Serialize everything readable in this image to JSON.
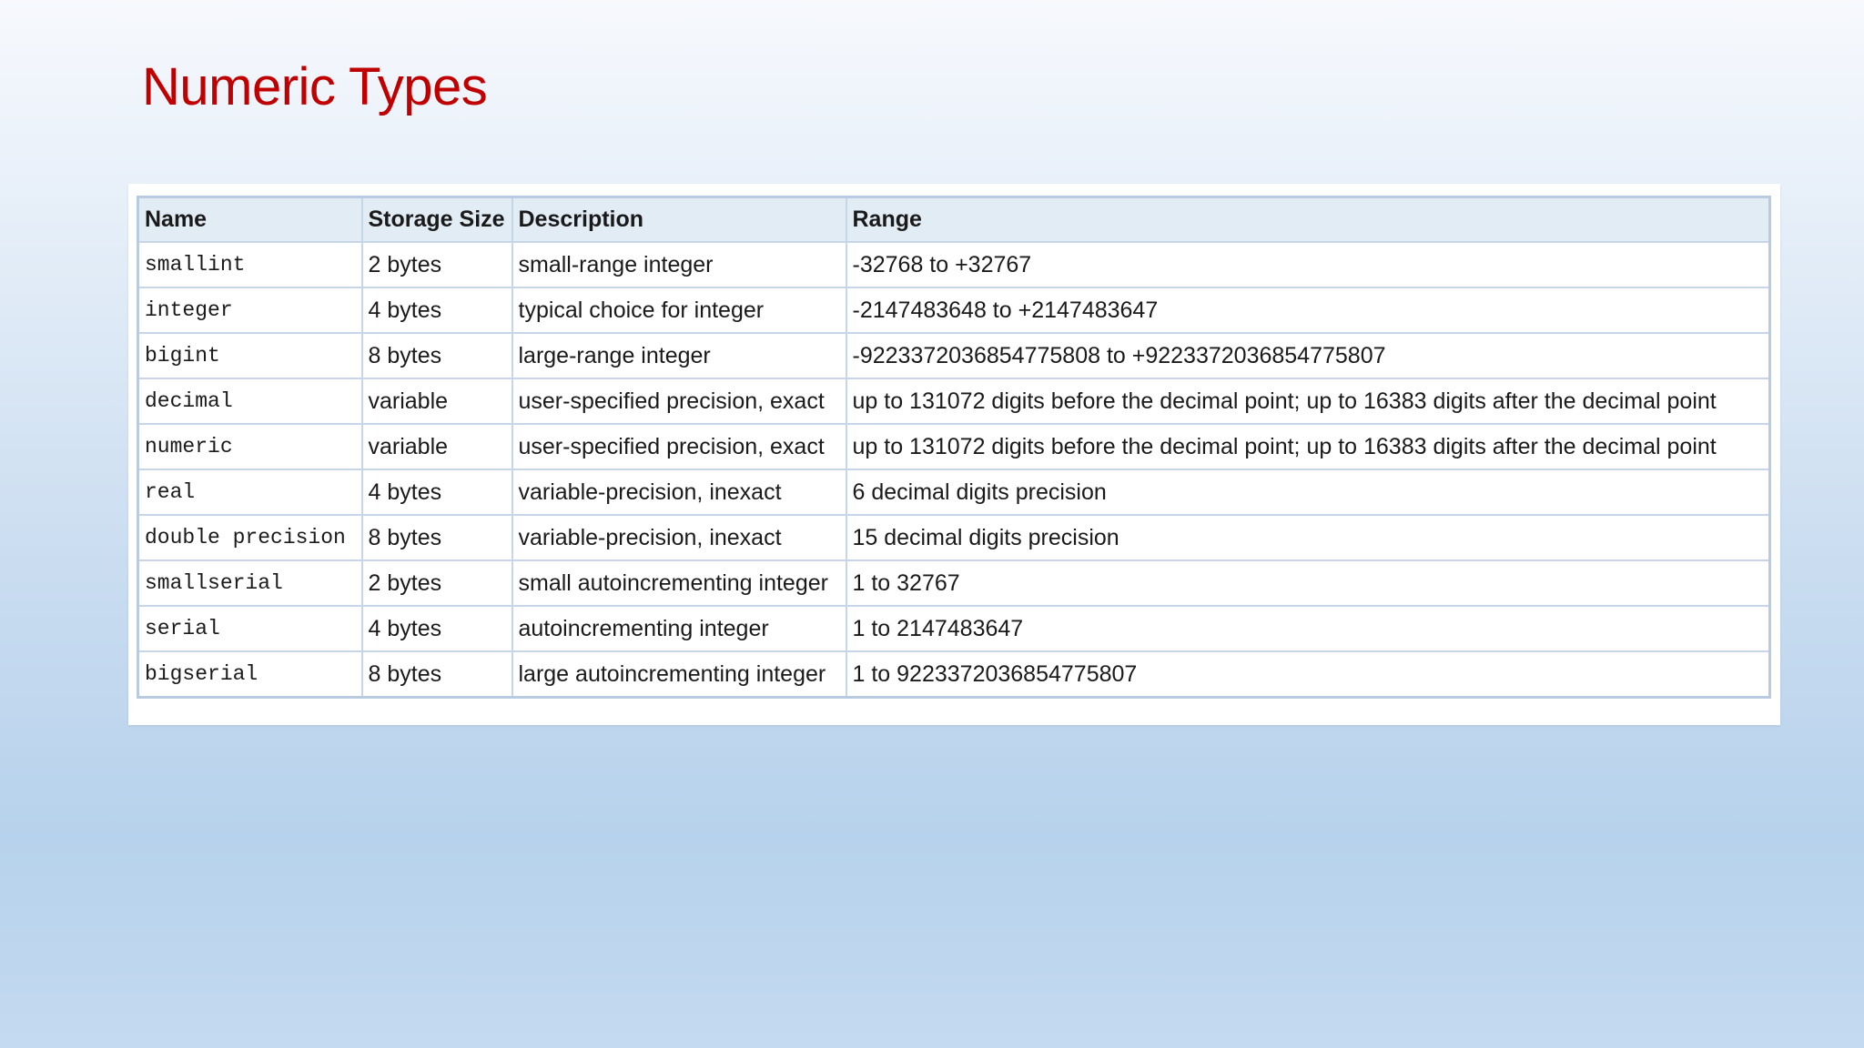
{
  "title": "Numeric Types",
  "table": {
    "headers": [
      "Name",
      "Storage Size",
      "Description",
      "Range"
    ],
    "rows": [
      [
        "smallint",
        "2 bytes",
        "small-range integer",
        "-32768 to +32767"
      ],
      [
        "integer",
        "4 bytes",
        "typical choice for integer",
        "-2147483648 to +2147483647"
      ],
      [
        "bigint",
        "8 bytes",
        "large-range integer",
        "-9223372036854775808 to +9223372036854775807"
      ],
      [
        "decimal",
        "variable",
        "user-specified precision, exact",
        "up to 131072 digits before the decimal point; up to 16383 digits after the decimal point"
      ],
      [
        "numeric",
        "variable",
        "user-specified precision, exact",
        "up to 131072 digits before the decimal point; up to 16383 digits after the decimal point"
      ],
      [
        "real",
        "4 bytes",
        "variable-precision, inexact",
        "6 decimal digits precision"
      ],
      [
        "double precision",
        "8 bytes",
        "variable-precision, inexact",
        "15 decimal digits precision"
      ],
      [
        "smallserial",
        "2 bytes",
        "small autoincrementing integer",
        "1 to 32767"
      ],
      [
        "serial",
        "4 bytes",
        "autoincrementing integer",
        "1 to 2147483647"
      ],
      [
        "bigserial",
        "8 bytes",
        "large autoincrementing integer",
        "1 to 9223372036854775807"
      ]
    ]
  },
  "colors": {
    "title": "#c00000",
    "header_bg": "#e2ecf5",
    "border": "#c6d6e8"
  }
}
